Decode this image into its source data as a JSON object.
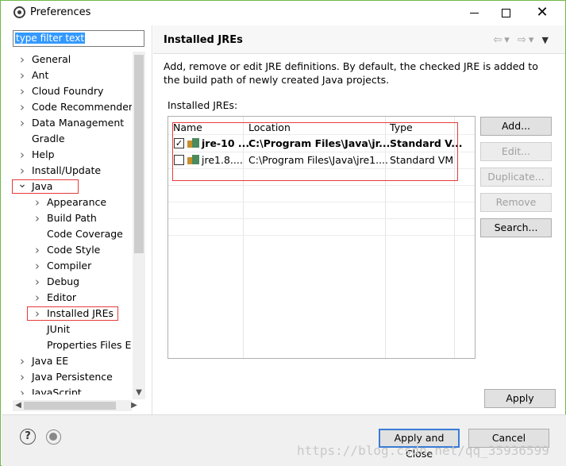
{
  "window": {
    "title": "Preferences"
  },
  "filter": {
    "placeholder": "type filter text"
  },
  "tree": {
    "items": [
      {
        "label": "General",
        "level": 0,
        "expander": "collapsed"
      },
      {
        "label": "Ant",
        "level": 0,
        "expander": "collapsed"
      },
      {
        "label": "Cloud Foundry",
        "level": 0,
        "expander": "collapsed"
      },
      {
        "label": "Code Recommenders",
        "level": 0,
        "expander": "collapsed"
      },
      {
        "label": "Data Management",
        "level": 0,
        "expander": "collapsed"
      },
      {
        "label": "Gradle",
        "level": 0,
        "expander": "none"
      },
      {
        "label": "Help",
        "level": 0,
        "expander": "collapsed"
      },
      {
        "label": "Install/Update",
        "level": 0,
        "expander": "collapsed"
      },
      {
        "label": "Java",
        "level": 0,
        "expander": "expanded"
      },
      {
        "label": "Appearance",
        "level": 1,
        "expander": "collapsed"
      },
      {
        "label": "Build Path",
        "level": 1,
        "expander": "collapsed"
      },
      {
        "label": "Code Coverage",
        "level": 1,
        "expander": "none"
      },
      {
        "label": "Code Style",
        "level": 1,
        "expander": "collapsed"
      },
      {
        "label": "Compiler",
        "level": 1,
        "expander": "collapsed"
      },
      {
        "label": "Debug",
        "level": 1,
        "expander": "collapsed"
      },
      {
        "label": "Editor",
        "level": 1,
        "expander": "collapsed"
      },
      {
        "label": "Installed JREs",
        "level": 1,
        "expander": "collapsed"
      },
      {
        "label": "JUnit",
        "level": 1,
        "expander": "none"
      },
      {
        "label": "Properties Files Ec",
        "level": 1,
        "expander": "none"
      },
      {
        "label": "Java EE",
        "level": 0,
        "expander": "collapsed"
      },
      {
        "label": "Java Persistence",
        "level": 0,
        "expander": "collapsed"
      },
      {
        "label": "JavaScript",
        "level": 0,
        "expander": "collapsed"
      }
    ]
  },
  "page": {
    "title": "Installed JREs",
    "description": "Add, remove or edit JRE definitions. By default, the checked JRE is added to the build path of newly created Java projects.",
    "list_label": "Installed JREs:"
  },
  "table": {
    "columns": [
      "Name",
      "Location",
      "Type"
    ],
    "rows": [
      {
        "checked": true,
        "name": "jre-10 ...",
        "location": "C:\\Program Files\\Java\\jr...",
        "type": "Standard V..."
      },
      {
        "checked": false,
        "name": "jre1.8....",
        "location": "C:\\Program Files\\Java\\jre1....",
        "type": "Standard VM"
      }
    ]
  },
  "buttons": {
    "add": "Add...",
    "edit": "Edit...",
    "duplicate": "Duplicate...",
    "remove": "Remove",
    "search": "Search...",
    "apply": "Apply",
    "apply_close": "Apply and Close",
    "cancel": "Cancel"
  },
  "icons": {
    "help": "help-icon",
    "record": "record-icon"
  },
  "watermark": "https://blog.csdn.net/qq_35936599",
  "colors": {
    "window_border": "#6fb84a",
    "highlight": "#e63b3b",
    "selection": "#3399ff",
    "primary_border": "#3a7bd5"
  }
}
